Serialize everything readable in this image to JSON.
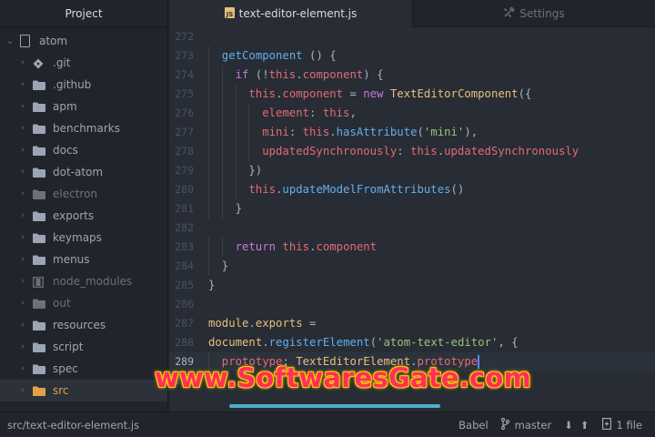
{
  "sidebar": {
    "title": "Project",
    "root": {
      "label": "atom"
    },
    "items": [
      {
        "label": ".git",
        "kind": "git-folder",
        "dim": false
      },
      {
        "label": ".github",
        "kind": "folder",
        "dim": false
      },
      {
        "label": "apm",
        "kind": "folder",
        "dim": false
      },
      {
        "label": "benchmarks",
        "kind": "folder",
        "dim": false
      },
      {
        "label": "docs",
        "kind": "folder",
        "dim": false
      },
      {
        "label": "dot-atom",
        "kind": "folder",
        "dim": false
      },
      {
        "label": "electron",
        "kind": "folder",
        "dim": true
      },
      {
        "label": "exports",
        "kind": "folder",
        "dim": false
      },
      {
        "label": "keymaps",
        "kind": "folder",
        "dim": false
      },
      {
        "label": "menus",
        "kind": "folder",
        "dim": false
      },
      {
        "label": "node_modules",
        "kind": "module",
        "dim": true
      },
      {
        "label": "out",
        "kind": "folder",
        "dim": true
      },
      {
        "label": "resources",
        "kind": "folder",
        "dim": false
      },
      {
        "label": "script",
        "kind": "folder",
        "dim": false
      },
      {
        "label": "spec",
        "kind": "folder",
        "dim": false
      },
      {
        "label": "src",
        "kind": "folder-open",
        "dim": false,
        "selected": true
      }
    ]
  },
  "tabs": [
    {
      "label": "text-editor-element.js",
      "icon": "js-file-icon",
      "active": true
    },
    {
      "label": "Settings",
      "icon": "tools-icon",
      "active": false
    }
  ],
  "editor": {
    "lines": [
      {
        "n": "272",
        "indent": 0,
        "tokens": []
      },
      {
        "n": "273",
        "indent": 1,
        "tokens": [
          [
            "f",
            "getComponent"
          ],
          [
            "p",
            " () {"
          ]
        ]
      },
      {
        "n": "274",
        "indent": 2,
        "tokens": [
          [
            "k",
            "if"
          ],
          [
            "p",
            " (!"
          ],
          [
            "t",
            "this"
          ],
          [
            "p",
            "."
          ],
          [
            "t",
            "component"
          ],
          [
            "p",
            ") {"
          ]
        ]
      },
      {
        "n": "275",
        "indent": 3,
        "tokens": [
          [
            "t",
            "this"
          ],
          [
            "p",
            "."
          ],
          [
            "t",
            "component"
          ],
          [
            "p",
            " = "
          ],
          [
            "k",
            "new"
          ],
          [
            "p",
            " "
          ],
          [
            "c",
            "TextEditorComponent"
          ],
          [
            "p",
            "({"
          ]
        ]
      },
      {
        "n": "276",
        "indent": 4,
        "tokens": [
          [
            "t",
            "element"
          ],
          [
            "p",
            ": "
          ],
          [
            "t",
            "this"
          ],
          [
            "p",
            ","
          ]
        ]
      },
      {
        "n": "277",
        "indent": 4,
        "tokens": [
          [
            "t",
            "mini"
          ],
          [
            "p",
            ": "
          ],
          [
            "t",
            "this"
          ],
          [
            "p",
            "."
          ],
          [
            "f",
            "hasAttribute"
          ],
          [
            "p",
            "("
          ],
          [
            "s",
            "'mini'"
          ],
          [
            "p",
            "),"
          ]
        ]
      },
      {
        "n": "278",
        "indent": 4,
        "tokens": [
          [
            "t",
            "updatedSynchronously"
          ],
          [
            "p",
            ": "
          ],
          [
            "t",
            "this"
          ],
          [
            "p",
            "."
          ],
          [
            "t",
            "updatedSynchronously"
          ]
        ]
      },
      {
        "n": "279",
        "indent": 3,
        "tokens": [
          [
            "p",
            "})"
          ]
        ]
      },
      {
        "n": "280",
        "indent": 3,
        "tokens": [
          [
            "t",
            "this"
          ],
          [
            "p",
            "."
          ],
          [
            "f",
            "updateModelFromAttributes"
          ],
          [
            "p",
            "()"
          ]
        ]
      },
      {
        "n": "281",
        "indent": 2,
        "tokens": [
          [
            "p",
            "}"
          ]
        ]
      },
      {
        "n": "282",
        "indent": 0,
        "tokens": []
      },
      {
        "n": "283",
        "indent": 2,
        "tokens": [
          [
            "k",
            "return"
          ],
          [
            "p",
            " "
          ],
          [
            "t",
            "this"
          ],
          [
            "p",
            "."
          ],
          [
            "t",
            "component"
          ]
        ]
      },
      {
        "n": "284",
        "indent": 1,
        "tokens": [
          [
            "p",
            "}"
          ]
        ]
      },
      {
        "n": "285",
        "indent": 0,
        "tokens": [
          [
            "p",
            "}"
          ]
        ]
      },
      {
        "n": "286",
        "indent": 0,
        "tokens": []
      },
      {
        "n": "287",
        "indent": 0,
        "tokens": [
          [
            "c",
            "module"
          ],
          [
            "p",
            "."
          ],
          [
            "c",
            "exports"
          ],
          [
            "p",
            " ="
          ]
        ]
      },
      {
        "n": "288",
        "indent": 0,
        "tokens": [
          [
            "c",
            "document"
          ],
          [
            "p",
            "."
          ],
          [
            "f",
            "registerElement"
          ],
          [
            "p",
            "("
          ],
          [
            "s",
            "'atom-text-editor'"
          ],
          [
            "p",
            ", {"
          ]
        ]
      },
      {
        "n": "289",
        "indent": 1,
        "cursor": true,
        "tokens": [
          [
            "t",
            "prototype"
          ],
          [
            "p",
            ": "
          ],
          [
            "c",
            "TextEditorElement"
          ],
          [
            "p",
            "."
          ],
          [
            "t",
            "prototype"
          ]
        ]
      },
      {
        "n": "290",
        "indent": 0,
        "tokens": [
          [
            "p",
            "})"
          ]
        ]
      }
    ]
  },
  "watermark": {
    "text": "www.SoftwaresGate.com"
  },
  "statusbar": {
    "path": "src/text-editor-element.js",
    "grammar": "Babel",
    "branch": "master",
    "changes": "1 file"
  }
}
